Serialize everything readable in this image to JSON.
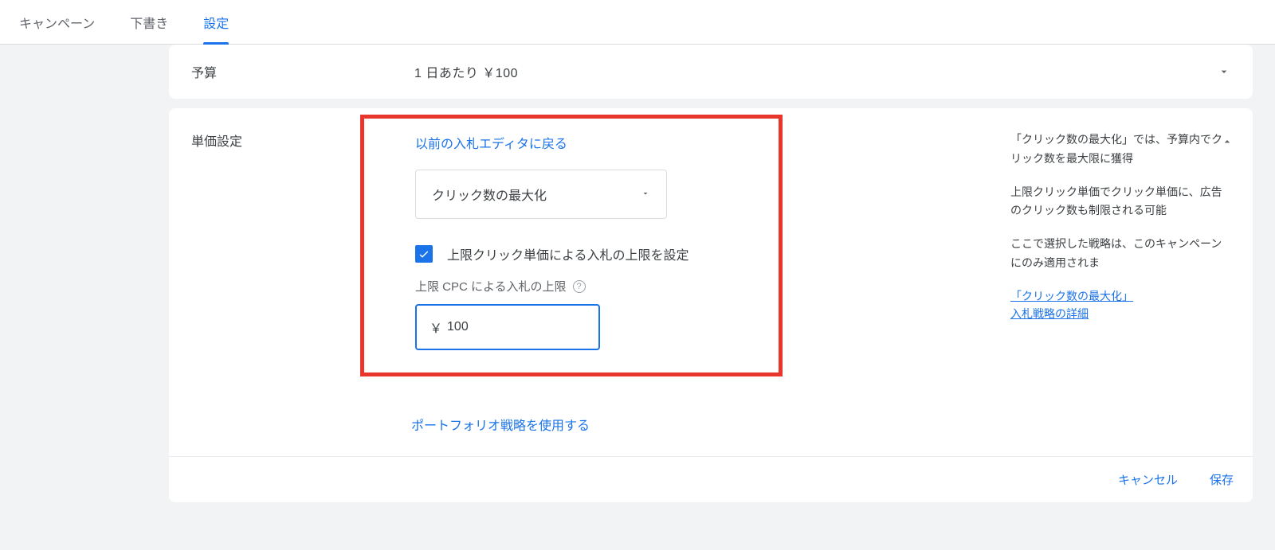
{
  "tabs": {
    "campaign": "キャンペーン",
    "draft": "下書き",
    "settings": "設定"
  },
  "budget": {
    "label": "予算",
    "value": "1 日あたり  ￥100"
  },
  "bidding": {
    "label": "単価設定",
    "back_link": "以前の入札エディタに戻る",
    "strategy_selected": "クリック数の最大化",
    "checkbox_label": "上限クリック単価による入札の上限を設定",
    "cpc_field_label": "上限 CPC による入札の上限",
    "currency": "￥",
    "cpc_value": "100",
    "portfolio_link": "ポートフォリオ戦略を使用する"
  },
  "info": {
    "p1": "「クリック数の最大化」では、予算内でクリック数を最大限に獲得",
    "p2": "上限クリック単価でクリック単価に、広告のクリック数も制限される可能",
    "p3": "ここで選択した戦略は、このキャンペーンにのみ適用されま",
    "link1": "「クリック数の最大化」",
    "link2": "入札戦略の詳細"
  },
  "footer": {
    "cancel": "キャンセル",
    "save": "保存"
  }
}
